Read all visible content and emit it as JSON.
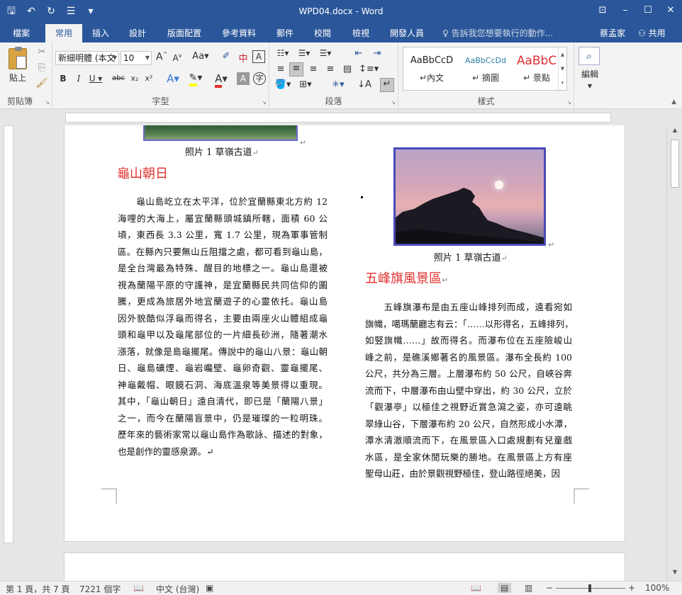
{
  "app": {
    "title": "WPD04.docx - Word",
    "user": "蔡孟家",
    "share_label": "共用",
    "tell_me": "告訴我您想要執行的動作..."
  },
  "tabs": [
    "檔案",
    "常用",
    "插入",
    "設計",
    "版面配置",
    "參考資料",
    "郵件",
    "校閱",
    "檢視",
    "開發人員"
  ],
  "ribbon": {
    "paste_label": "貼上",
    "clipboard_label": "剪貼簿",
    "font_label": "字型",
    "paragraph_label": "段落",
    "styles_label": "樣式",
    "editing_label": "編輯",
    "font_name": "新細明體 (本文",
    "font_size": "10",
    "style_sample": "AaBbCcD",
    "style_sample2": "AaBbCcDd",
    "style_sample3": "AaBbC",
    "style_name_1": "↵內文",
    "style_name_2": "↵ 摘圖",
    "style_name_3": "↵ 景點"
  },
  "doc": {
    "caption1": "照片 1 草嶺古道",
    "caption2": "照片 1 草嶺古道",
    "heading1": "龜山朝日",
    "heading2": "五峰旗風景區",
    "para1": [
      "　　龜山島屹立在太平洋，位於宜蘭縣東北方約 12",
      "海哩的大海上，屬宜蘭縣頭城鎮所轄，面積 60 公",
      "頃，東西長 3.3 公里，寬 1.7 公里，現為軍事管制",
      "區。在縣內只要無山丘阻擋之處，都可看到龜山島，",
      "是全台灣最為特殊、醒目的地標之一。龜山島還被",
      "視為蘭陽平原的守護神，是宜蘭縣民共同信仰的圖",
      "騰，更成為旅居外地宜蘭遊子的心靈依托。龜山島",
      "因外貌酷似浮龜而得名，主要由兩座火山體組成龜",
      "頭和龜甲以及龜尾部位的一片細長砂洲，隨著潮水",
      "漲落，就像是島龜擺尾。傳說中的龜山八景：龜山朝",
      "日、龜島礦煙、龜岩巉壁、龜卵奇觀、靈龜擺尾、",
      "神龜戴帽、眼鏡石洞、海底溫泉等美景得以重現。",
      "其中，「龜山朝日」遠自清代，即已是「蘭陽八景」",
      "之一，而今在蘭陽盲景中，仍是璀璨的一粒明珠。",
      "歷年來的藝術家常以龜山島作為歌詠、描述的對象，",
      "也是創作的靈感泉源。↵"
    ],
    "para2": [
      "　　五峰旗瀑布是由五座山峰排列而成，遠看宛如",
      "旗幟，噶瑪蘭廳志有云：「……以形得名，五峰排列，",
      "如竪旗幟……」故而得名。而瀑布位在五座險峻山",
      "峰之前，是礁溪鄉著名的風景區。瀑布全長約 100",
      "公尺，共分為三層。上層瀑布約 50 公尺，自峽谷奔",
      "流而下，中層瀑布由山壁中穿出，約 30 公尺，立於",
      "「觀瀑亭」以極佳之視野近賞急瀉之姿，亦可遠眺",
      "翠綠山谷，下層瀑布約 20 公尺，自然形成小水潭，",
      "潭水清澈順流而下，在風景區入口處規劃有兒童戲",
      "水區，是全家休閒玩樂的勝地。在風景區上方有座",
      "聖母山莊，由於景觀視野極佳，登山路徑絕美，因"
    ]
  },
  "status": {
    "page": "第 1 頁，共 7 頁",
    "words": "7221 個字",
    "lang": "中文 (台灣)",
    "zoom": "100%"
  },
  "colors": {
    "brand": "#2b579a",
    "heading": "#e0302f"
  }
}
